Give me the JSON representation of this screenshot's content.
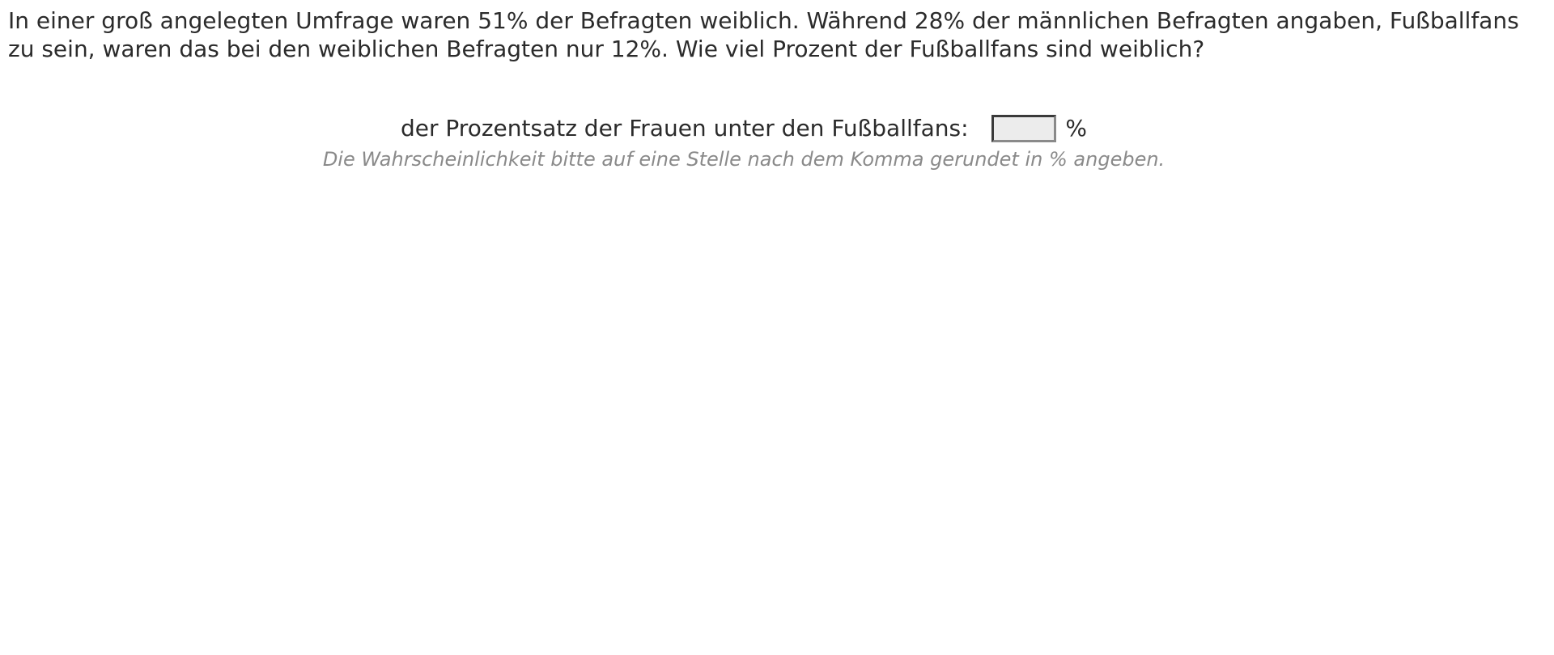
{
  "question": {
    "text": "In einer groß angelegten Umfrage waren 51% der Befragten weiblich. Während 28% der männlichen Befragten angaben, Fußballfans zu sein, waren das bei den weiblichen Befragten nur 12%. Wie viel Prozent der Fußballfans sind weiblich?"
  },
  "answer": {
    "label": "der Prozentsatz der Frauen unter den Fußballfans:",
    "value": "",
    "unit": "%"
  },
  "hint": {
    "text": "Die Wahrscheinlichkeit bitte auf eine Stelle nach dem Komma gerundet in % angeben."
  }
}
